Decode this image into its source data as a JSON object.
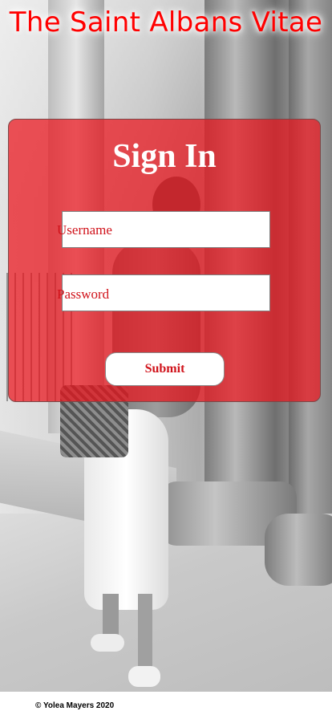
{
  "site": {
    "title": "The Saint Albans Vitae"
  },
  "signin": {
    "heading": "Sign In",
    "username_label": "Username",
    "password_label": "Password",
    "submit_label": "Submit"
  },
  "footer": {
    "text": "© Yolea Mayers 2020"
  },
  "colors": {
    "title_red": "#ff0000",
    "panel_red": "#ec141c",
    "label_red": "#d0121a"
  }
}
